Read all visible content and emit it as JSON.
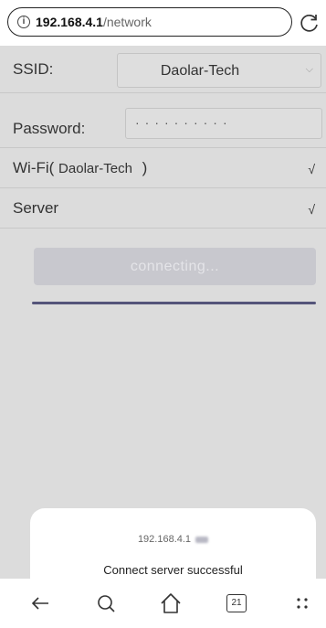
{
  "browser": {
    "url_host": "192.168.4.1",
    "url_path": "/network",
    "info_icon": "info-icon",
    "reload_icon": "reload-icon"
  },
  "form": {
    "ssid_label": "SSID:",
    "ssid_value": "Daolar-Tech",
    "password_label": "Password:",
    "password_value": "··········",
    "wifi_label": "Wi-Fi(",
    "wifi_name": "Daolar-Tech",
    "wifi_close": ")",
    "wifi_check": "√",
    "server_label": "Server",
    "server_check": "√",
    "connect_button": "connecting..."
  },
  "dialog": {
    "host": "192.168.4.1",
    "message": "Connect server successful"
  },
  "navbar": {
    "tab_count": "21",
    "icons": [
      "back-arrow-icon",
      "search-icon",
      "home-icon",
      "tabs-icon",
      "menu-dots-icon"
    ]
  },
  "colors": {
    "content_bg": "#dcdcdc",
    "button_bg": "#c8c8ce",
    "progress": "#55557a",
    "dialog_bg": "#ffffff"
  }
}
